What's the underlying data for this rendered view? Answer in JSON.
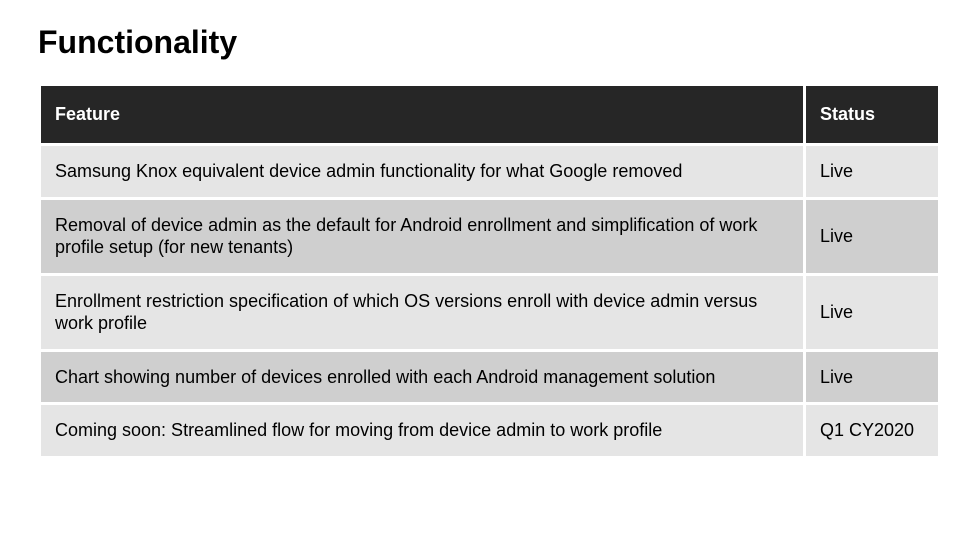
{
  "title": "Functionality",
  "columns": {
    "feature": "Feature",
    "status": "Status"
  },
  "rows": [
    {
      "feature": "Samsung Knox equivalent device admin functionality for what Google removed",
      "status": "Live"
    },
    {
      "feature": "Removal of device admin as the default for Android enrollment and simplification of work profile setup (for new tenants)",
      "status": "Live"
    },
    {
      "feature": "Enrollment restriction specification of which OS versions enroll with device admin versus work profile",
      "status": "Live"
    },
    {
      "feature": "Chart showing number of devices enrolled with each Android management solution",
      "status": "Live"
    },
    {
      "feature": "Coming soon: Streamlined flow for moving from device admin to work profile",
      "status": "Q1 CY2020"
    }
  ]
}
